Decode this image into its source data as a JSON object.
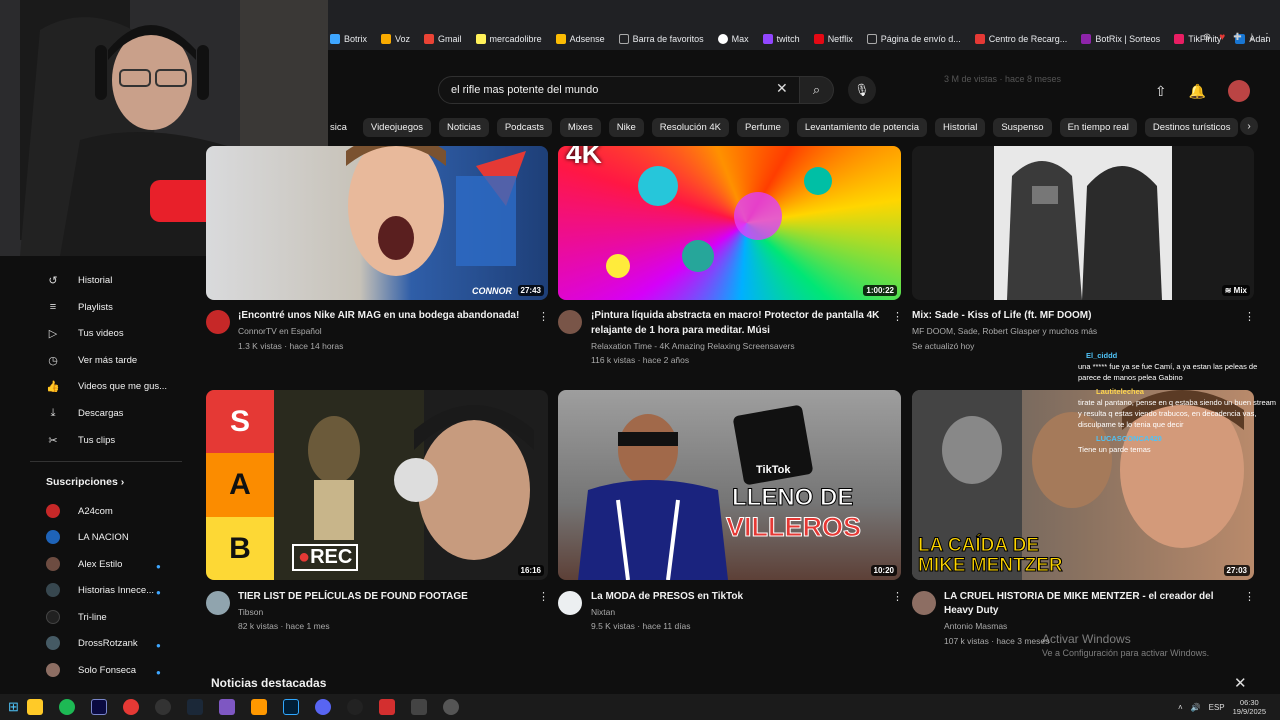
{
  "bookmarks": [
    "Botrix",
    "Voz",
    "Gmail",
    "mercadolibre",
    "Adsense",
    "Barra de favoritos",
    "Max",
    "twitch",
    "Netflix",
    "Página de envío d...",
    "Centro de Recarg...",
    "BotRix | Sorteos",
    "TikFinity",
    "Adan"
  ],
  "header": {
    "search_value": "el rifle mas potente del mundo",
    "faded_meta": "3 M de vistas · hace 8 meses"
  },
  "chips": [
    "sica",
    "Videojuegos",
    "Noticias",
    "Podcasts",
    "Mixes",
    "Nike",
    "Resolución 4K",
    "Perfume",
    "Levantamiento de potencia",
    "Historial",
    "Suspenso",
    "En tiempo real",
    "Destinos turísticos"
  ],
  "sidebar": {
    "items": [
      {
        "label": "Historial",
        "icon": "history-icon"
      },
      {
        "label": "Playlists",
        "icon": "playlist-icon"
      },
      {
        "label": "Tus videos",
        "icon": "video-icon"
      },
      {
        "label": "Ver más tarde",
        "icon": "clock-icon"
      },
      {
        "label": "Videos que me gus...",
        "icon": "thumbs-up-icon"
      },
      {
        "label": "Descargas",
        "icon": "download-icon"
      },
      {
        "label": "Tus clips",
        "icon": "scissors-icon"
      }
    ],
    "subs_title": "Suscripciones",
    "subscriptions": [
      {
        "label": "A24com",
        "color": "#c62828"
      },
      {
        "label": "LA NACION",
        "color": "#1e63b8"
      },
      {
        "label": "Alex Estilo",
        "color": "#6d4c41"
      },
      {
        "label": "Historias Innece...",
        "color": "#37474f"
      },
      {
        "label": "Tri-line",
        "color": "#212121"
      },
      {
        "label": "DrossRotzank",
        "color": "#455a64"
      },
      {
        "label": "Solo Fonseca",
        "color": "#8d6e63"
      }
    ]
  },
  "videos": [
    {
      "title": "¡Encontré unos Nike AIR MAG en una bodega abandonada!",
      "channel": "ConnorTV en Español",
      "meta": "1.3 K vistas · hace 14 horas",
      "duration": "27:43",
      "watermark": "CONNOR"
    },
    {
      "title_l1": "¡Pintura líquida abstracta en macro! Protector de pantalla 4K",
      "title_l2": "relajante de 1 hora para meditar. Músi",
      "channel": "Relaxation Time - 4K Amazing Relaxing Screensavers",
      "meta": "116 k vistas · hace 2 años",
      "duration": "1:00:22",
      "badge": "4K"
    },
    {
      "title": "Mix: Sade - Kiss of Life (ft. MF DOOM)",
      "channel": "MF DOOM, Sade, Robert Glasper y muchos más",
      "meta": "Se actualizó hoy",
      "duration": "Mix"
    },
    {
      "title": "TIER LIST DE PELÍCULAS DE FOUND FOOTAGE",
      "channel": "Tibson",
      "meta": "82 k vistas · hace 1 mes",
      "duration": "16:16",
      "tiers": [
        "S",
        "A",
        "B"
      ],
      "rec": "REC"
    },
    {
      "title": "La MODA de PRESOS en TikTok",
      "channel": "Nixtan",
      "meta": "9.5 K vistas · hace 11 días",
      "duration": "10:20",
      "overlay_l1": "LLENO DE",
      "overlay_l2": "VILLEROS",
      "tiktok": "TikTok"
    },
    {
      "title_l1": "LA CRUEL HISTORIA DE MIKE MENTZER - el creador del",
      "title_l2": "Heavy Duty",
      "channel": "Antonio Masmas",
      "meta": "107 k vistas · hace 3 meses",
      "duration": "27:03",
      "overlay_l1": "LA CAÍDA DE",
      "overlay_l2": "MIKE MENTZER"
    }
  ],
  "section_title": "Noticias destacadas",
  "chat": [
    {
      "name": "El_ciddd",
      "text": "una ***** fue ya se fue Camí, a ya estan las peleas de parece de manos pelea Gabino",
      "gold": false
    },
    {
      "name": "Lautitelechea",
      "text": "tirate al pantano, pense en q estaba siendo un buen stream y resulta q estas viendo trabucos, en decadencia vas, disculpame te lo tenia que decir",
      "gold": true
    },
    {
      "name": "LUCASCONCA420",
      "text": "Tiene un parde temas",
      "gold": false
    }
  ],
  "windows": {
    "activate_l1": "Activar Windows",
    "activate_l2": "Ve a Configuración para activar Windows.",
    "lang": "ESP",
    "time": "06:30",
    "date": "19/9/2025"
  }
}
